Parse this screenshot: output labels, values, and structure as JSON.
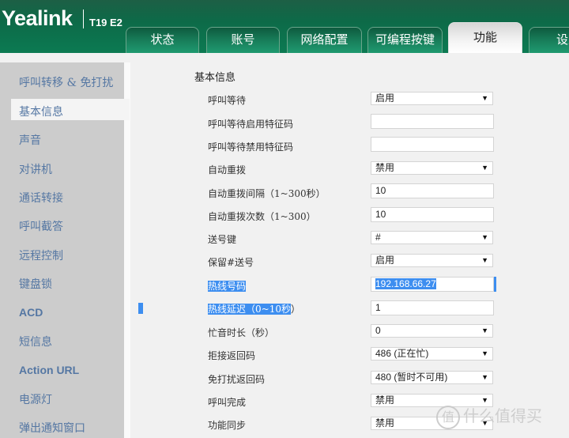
{
  "header": {
    "brand": "Yealink",
    "model": "T19 E2",
    "tabs": [
      {
        "label": "状态",
        "active": false
      },
      {
        "label": "账号",
        "active": false
      },
      {
        "label": "网络配置",
        "active": false
      },
      {
        "label": "可编程按键",
        "active": false
      },
      {
        "label": "功能",
        "active": true
      },
      {
        "label": "设置",
        "active": false
      }
    ]
  },
  "sidebar": {
    "items": [
      {
        "label": "呼叫转移 & 免打扰"
      },
      {
        "label": "基本信息",
        "active": true
      },
      {
        "label": "声音"
      },
      {
        "label": "对讲机"
      },
      {
        "label": "通话转接"
      },
      {
        "label": "呼叫截答"
      },
      {
        "label": "远程控制"
      },
      {
        "label": "键盘锁"
      },
      {
        "label": "ACD"
      },
      {
        "label": "短信息"
      },
      {
        "label": "Action URL"
      },
      {
        "label": "电源灯"
      },
      {
        "label": "弹出通知窗口"
      }
    ]
  },
  "main": {
    "section_title": "基本信息",
    "rows": [
      {
        "label": "呼叫等待",
        "type": "select",
        "value": "启用"
      },
      {
        "label": "呼叫等待启用特征码",
        "type": "input",
        "value": ""
      },
      {
        "label": "呼叫等待禁用特征码",
        "type": "input",
        "value": ""
      },
      {
        "label": "自动重拨",
        "type": "select",
        "value": "禁用"
      },
      {
        "label": "自动重拨间隔（1~300秒）",
        "type": "input",
        "value": "10"
      },
      {
        "label": "自动重拨次数（1~300）",
        "type": "input",
        "value": "10"
      },
      {
        "label": "送号键",
        "type": "select",
        "value": "#"
      },
      {
        "label": "保留#送号",
        "type": "select",
        "value": "启用"
      },
      {
        "label": "热线号码",
        "type": "input",
        "value": "192.168.66.27",
        "selected": true
      },
      {
        "label_selected": "热线延迟（0~10秒",
        "label_rest": "）",
        "type": "input",
        "value": "1"
      },
      {
        "label": "忙音时长（秒）",
        "type": "select",
        "value": "0"
      },
      {
        "label": "拒接返回码",
        "type": "select",
        "value": "486 (正在忙)"
      },
      {
        "label": "免打扰返回码",
        "type": "select",
        "value": "480 (暂时不可用)"
      },
      {
        "label": "呼叫完成",
        "type": "select",
        "value": "禁用"
      },
      {
        "label": "功能同步",
        "type": "select",
        "value": "禁用"
      }
    ],
    "dropdown_arrow": "▼"
  },
  "watermark": {
    "badge": "值",
    "text": "什么值得买"
  }
}
